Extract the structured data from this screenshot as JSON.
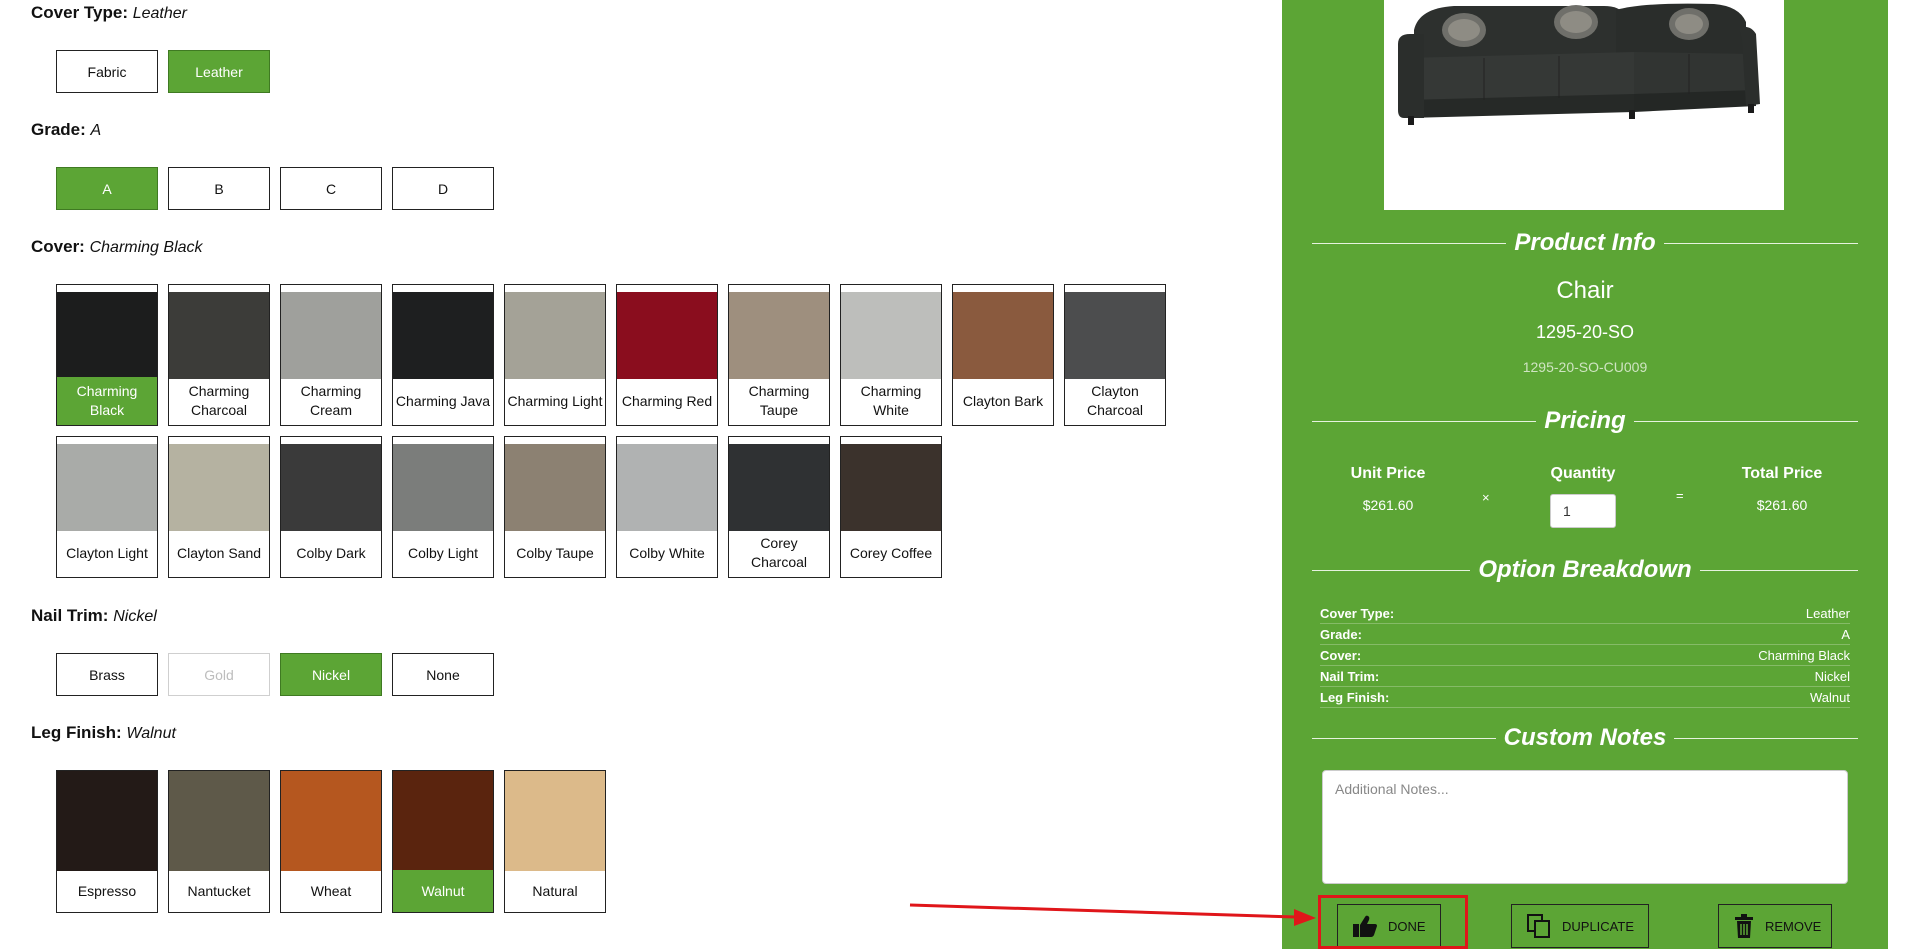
{
  "options": {
    "cover_type": {
      "label": "Cover Type:",
      "selected": "Leather",
      "choices": [
        "Fabric",
        "Leather"
      ]
    },
    "grade": {
      "label": "Grade:",
      "selected": "A",
      "choices": [
        "A",
        "B",
        "C",
        "D"
      ]
    },
    "cover": {
      "label": "Cover:",
      "selected": "Charming Black",
      "swatches": [
        {
          "name": "Charming Black",
          "color": "#1c1d1d"
        },
        {
          "name": "Charming Charcoal",
          "color": "#3c3c39"
        },
        {
          "name": "Charming Cream",
          "color": "#9fa09c"
        },
        {
          "name": "Charming Java",
          "color": "#1e1f20"
        },
        {
          "name": "Charming Light",
          "color": "#a4a297"
        },
        {
          "name": "Charming Red",
          "color": "#8a0d1e"
        },
        {
          "name": "Charming Taupe",
          "color": "#9e8f7e"
        },
        {
          "name": "Charming White",
          "color": "#bdbebb"
        },
        {
          "name": "Clayton Bark",
          "color": "#8a5a3e"
        },
        {
          "name": "Clayton Charcoal",
          "color": "#4c4d4e"
        },
        {
          "name": "Clayton Light",
          "color": "#a9aba8"
        },
        {
          "name": "Clayton Sand",
          "color": "#b5b2a1"
        },
        {
          "name": "Colby Dark",
          "color": "#3a3a3a"
        },
        {
          "name": "Colby Light",
          "color": "#7b7d7b"
        },
        {
          "name": "Colby Taupe",
          "color": "#8c8172"
        },
        {
          "name": "Colby White",
          "color": "#b0b2b2"
        },
        {
          "name": "Corey Charcoal",
          "color": "#2f3133"
        },
        {
          "name": "Corey Coffee",
          "color": "#3b322c"
        }
      ]
    },
    "nail_trim": {
      "label": "Nail Trim:",
      "selected": "Nickel",
      "choices": [
        "Brass",
        "Gold",
        "Nickel",
        "None"
      ],
      "disabled": [
        "Gold"
      ]
    },
    "leg_finish": {
      "label": "Leg Finish:",
      "selected": "Walnut",
      "swatches": [
        {
          "name": "Espresso",
          "color": "#231a17"
        },
        {
          "name": "Nantucket",
          "color": "#5e5949"
        },
        {
          "name": "Wheat",
          "color": "#b5571f"
        },
        {
          "name": "Walnut",
          "color": "#5a240e"
        },
        {
          "name": "Natural",
          "color": "#dcba8a"
        }
      ]
    }
  },
  "summary": {
    "product_info_title": "Product Info",
    "product_name": "Chair",
    "product_code": "1295-20-SO",
    "product_sku": "1295-20-SO-CU009",
    "pricing_title": "Pricing",
    "unit_price_label": "Unit Price",
    "unit_price": "$261.60",
    "times_symbol": "×",
    "quantity_label": "Quantity",
    "quantity": "1",
    "equals_symbol": "=",
    "total_price_label": "Total Price",
    "total_price": "$261.60",
    "breakdown_title": "Option Breakdown",
    "breakdown": [
      {
        "key": "Cover Type:",
        "value": "Leather"
      },
      {
        "key": "Grade:",
        "value": "A"
      },
      {
        "key": "Cover:",
        "value": "Charming Black"
      },
      {
        "key": "Nail Trim:",
        "value": "Nickel"
      },
      {
        "key": "Leg Finish:",
        "value": "Walnut"
      }
    ],
    "notes_title": "Custom Notes",
    "notes_placeholder": "Additional Notes...",
    "actions": {
      "done": "DONE",
      "duplicate": "DUPLICATE",
      "remove": "REMOVE"
    }
  },
  "colors": {
    "accent_green": "#5ca535",
    "annotation_red": "#e0161a"
  }
}
